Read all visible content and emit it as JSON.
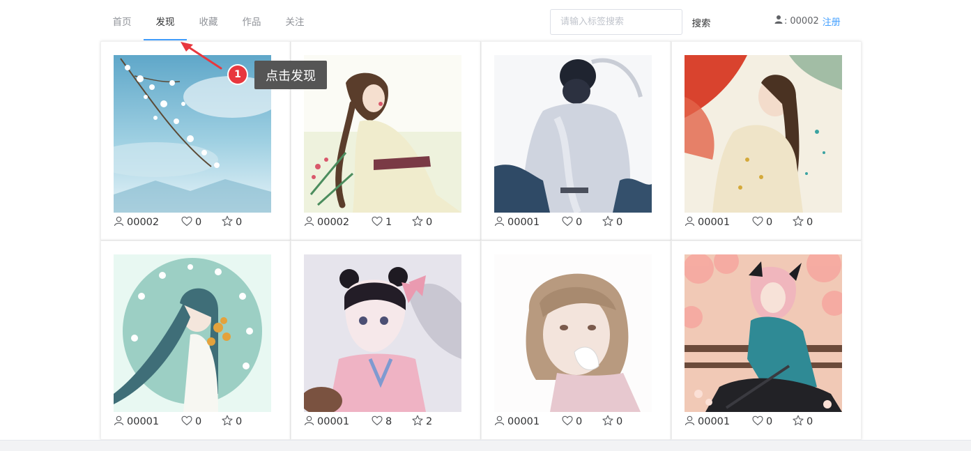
{
  "nav": {
    "items": [
      {
        "label": "首页"
      },
      {
        "label": "发现"
      },
      {
        "label": "收藏"
      },
      {
        "label": "作品"
      },
      {
        "label": "关注"
      }
    ],
    "active_index": 1
  },
  "search": {
    "placeholder": "请输入标签搜索",
    "value": "",
    "button_label": "搜索"
  },
  "user": {
    "icon": "user-icon",
    "separator": ":",
    "id": "00002",
    "register_label": "注册"
  },
  "colors": {
    "accent": "#409eff",
    "badge": "#e8373e",
    "tooltip_bg": "#555555"
  },
  "cards": [
    {
      "author": "00002",
      "likes": "0",
      "stars": "0"
    },
    {
      "author": "00002",
      "likes": "1",
      "stars": "0"
    },
    {
      "author": "00001",
      "likes": "0",
      "stars": "0"
    },
    {
      "author": "00001",
      "likes": "0",
      "stars": "0"
    },
    {
      "author": "00001",
      "likes": "0",
      "stars": "0"
    },
    {
      "author": "00001",
      "likes": "8",
      "stars": "2"
    },
    {
      "author": "00001",
      "likes": "0",
      "stars": "0"
    },
    {
      "author": "00001",
      "likes": "0",
      "stars": "0"
    }
  ],
  "annotation": {
    "step": "1",
    "text": "点击发现"
  }
}
